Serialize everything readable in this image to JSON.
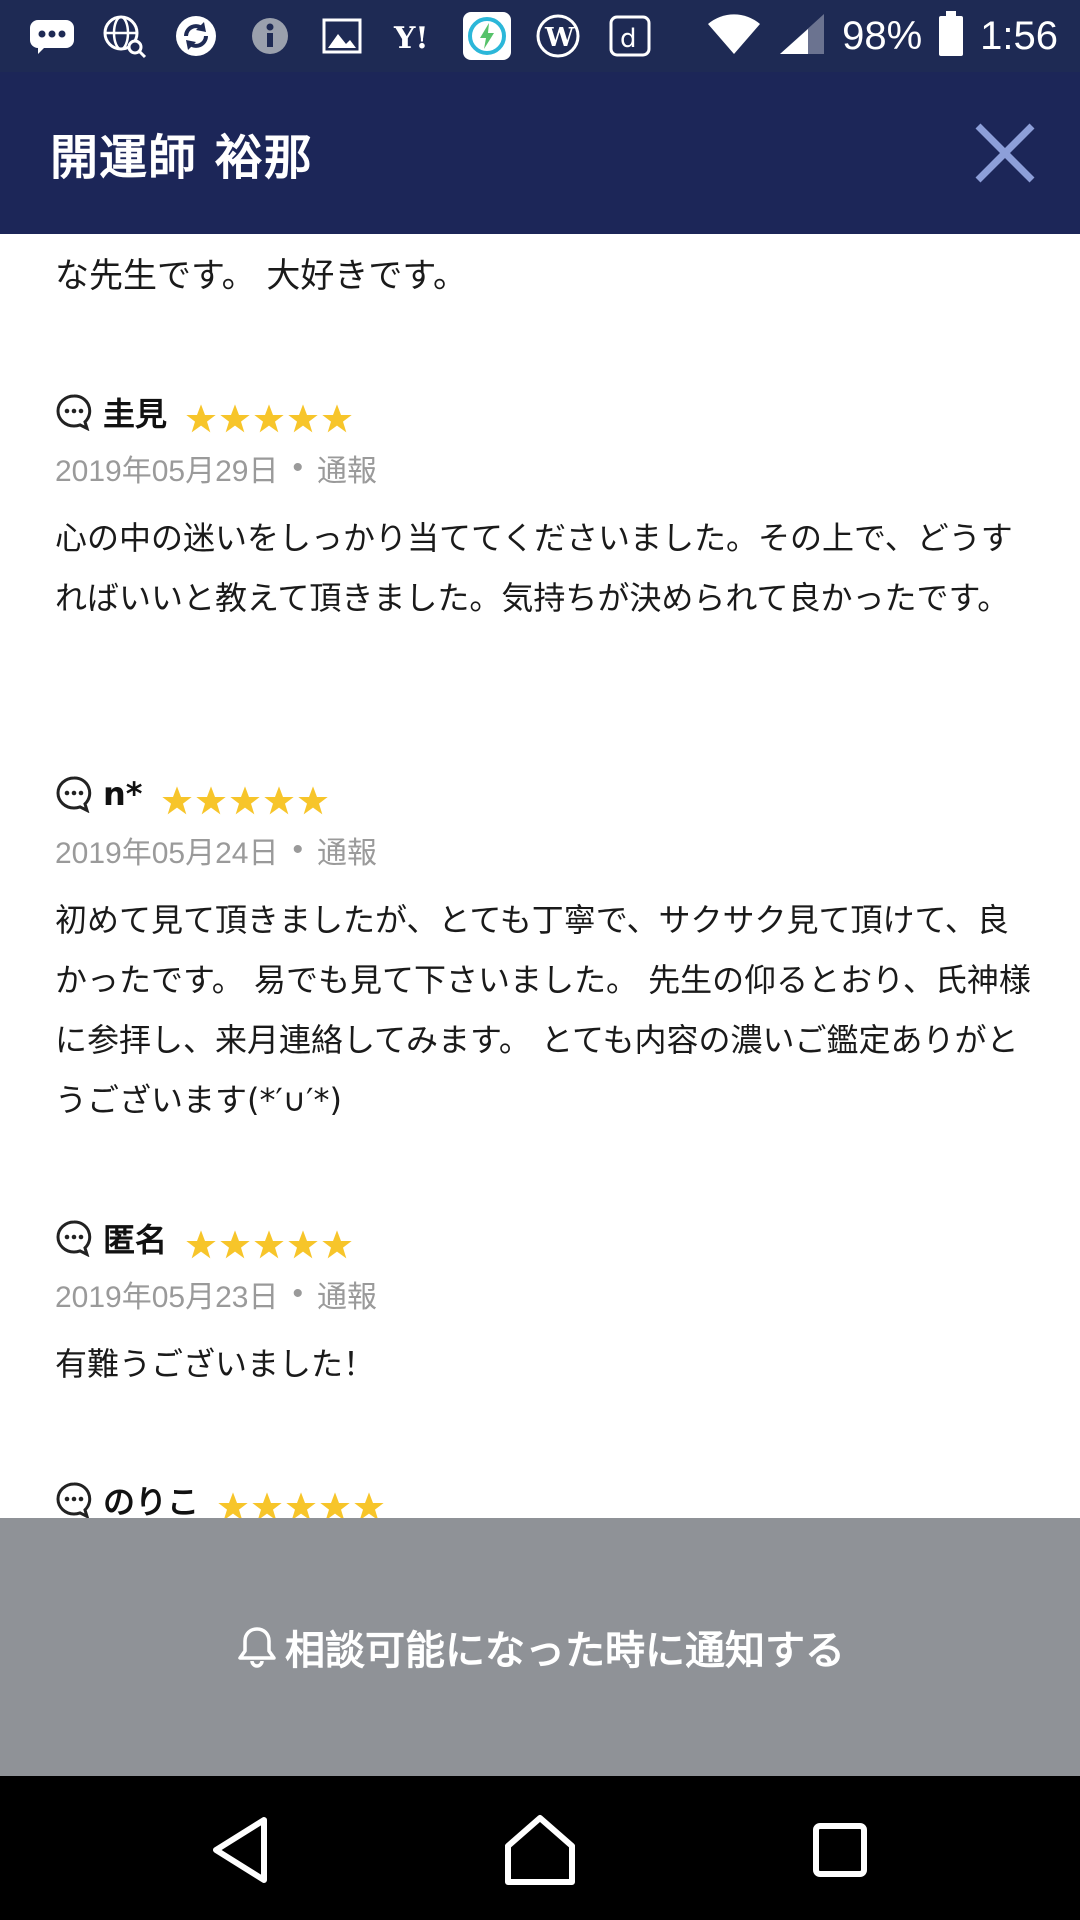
{
  "status_bar": {
    "icons": [
      "message-icon",
      "globe-search-icon",
      "sync-icon",
      "info-icon",
      "image-icon",
      "yahoo-icon",
      "battery-saver-icon",
      "wordpress-icon",
      "d-app-icon"
    ],
    "battery": "98%",
    "time": "1:56"
  },
  "header": {
    "title": "開運師 裕那"
  },
  "partial_review_text": "な先生です。 大好きです。",
  "reviews": [
    {
      "name": "圭見",
      "rating": 5,
      "date": "2019年05月29日",
      "report": "通報",
      "body": "心の中の迷いをしっかり当ててくださいました。その上で、どうすればいいと教えて頂きました。気持ちが決められて良かったです。"
    },
    {
      "name": "n*",
      "rating": 5,
      "date": "2019年05月24日",
      "report": "通報",
      "body": "初めて見て頂きましたが、とても丁寧で、サクサク見て頂けて、良かったです。 易でも見て下さいました。 先生の仰るとおり、氏神様に参拝し、来月連絡してみます。 とても内容の濃いご鑑定ありがとうございます(*′∪′*)"
    },
    {
      "name": "匿名",
      "rating": 5,
      "date": "2019年05月23日",
      "report": "通報",
      "body": "有難うございました！"
    },
    {
      "name": "のりこ",
      "rating": 5
    }
  ],
  "notify_button": {
    "label": "相談可能になった時に通知する"
  },
  "colors": {
    "header_bg": "#1c2658",
    "status_bg": "#1e2a54",
    "star": "#f7c52a",
    "notify_bg": "#8f9297",
    "meta_text": "#9a9a9a"
  }
}
